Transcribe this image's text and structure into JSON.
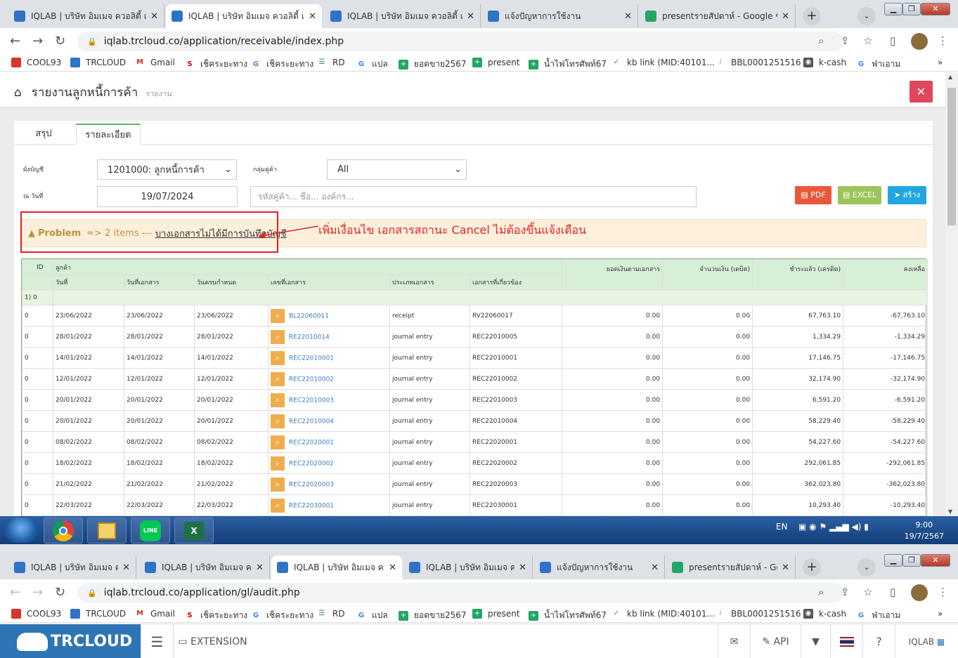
{
  "browser1": {
    "tabs": [
      {
        "title": "IQLAB | บริษัท อิมเมจ ควอลิตี้ แล็บ",
        "active": false
      },
      {
        "title": "IQLAB | บริษัท อิมเมจ ควอลิตี้ แล็บ",
        "active": true
      },
      {
        "title": "IQLAB | บริษัท อิมเมจ ควอลิตี้ แล็บ",
        "active": false
      },
      {
        "title": "แจ้งปัญหาการใช้งาน",
        "active": false
      },
      {
        "title": "presentรายสัปดาห์ - Google ชีต",
        "active": false
      }
    ],
    "url": "iqlab.trcloud.co/application/receivable/index.php"
  },
  "bookmarks": [
    "COOL93",
    "TRCLOUD",
    "Gmail",
    "เช็คระยะทาง",
    "เช็คระยะทาง",
    "RD",
    "แปล",
    "ยอดขาย2567",
    "present",
    "น้ำไฟโทรศัพท์67",
    "kb link (MID:40101...",
    "BBL0001251516",
    "k-cash",
    "ฟ่าเอาม"
  ],
  "page": {
    "title": "รายงานลูกหนี้การค้า",
    "subtitle": "รายงาน",
    "tabs": [
      "สรุป",
      "รายละเอียด"
    ],
    "filters": {
      "account_label": "ผังบัญชี",
      "account_value": "1201000: ลูกหนี้การค้า",
      "group_label": "กลุ่มคู่ค้า",
      "group_value": "All",
      "date_label": "ณ วันที่",
      "date_value": "19/07/2024",
      "search_placeholder": "รหัสคู่ค้า... ชื่อ... องค์กร..."
    },
    "buttons": {
      "pdf": "PDF",
      "excel": "EXCEL",
      "create": "สร้าง"
    },
    "alert": {
      "title": "Problem",
      "text": "=> 2 items ---",
      "link": "บางเอกสารไม่ได้มีการบันทึกบัญชี"
    },
    "annotation": "เพิ่มเงื่อนไข เอกสารสถานะ Cancel ไม่ต้องขึ้นแจ้งเตือน"
  },
  "table": {
    "h_id": "ID",
    "h_customer": "ลูกค้า",
    "h_doc_amount": "ยอดเงินตามเอกสาร",
    "h_debit": "จำนวนเงิน (เดบิต)",
    "h_credit": "ชำระแล้ว (เครดิต)",
    "h_balance": "คงเหลือ",
    "h_date": "วันที่",
    "h_doc_date": "วันที่เอกสาร",
    "h_due": "วันครบกำหนด",
    "h_doc_no": "เลขที่เอกสาร",
    "h_doc_type": "ประเภทเอกสาร",
    "h_ref": "เอกสารที่เกี่ยวข้อง",
    "group": {
      "idx": "1)",
      "id": "0"
    },
    "rows": [
      [
        "0",
        "23/06/2022",
        "23/06/2022",
        "23/06/2022",
        "BL22060011",
        "receipt",
        "RV22060017",
        "0.00",
        "0.00",
        "67,763.10",
        "-67,763.10"
      ],
      [
        "0",
        "28/01/2022",
        "28/01/2022",
        "28/01/2022",
        "RE22010014",
        "journal entry",
        "REC22010005",
        "0.00",
        "0.00",
        "1,334.29",
        "-1,334.29"
      ],
      [
        "0",
        "14/01/2022",
        "14/01/2022",
        "14/01/2022",
        "REC22010001",
        "journal entry",
        "REC22010001",
        "0.00",
        "0.00",
        "17,146.75",
        "-17,146.75"
      ],
      [
        "0",
        "12/01/2022",
        "12/01/2022",
        "12/01/2022",
        "REC22010002",
        "journal entry",
        "REC22010002",
        "0.00",
        "0.00",
        "32,174.90",
        "-32,174.90"
      ],
      [
        "0",
        "20/01/2022",
        "20/01/2022",
        "20/01/2022",
        "REC22010003",
        "journal entry",
        "REC22010003",
        "0.00",
        "0.00",
        "6,591.20",
        "-6,591.20"
      ],
      [
        "0",
        "20/01/2022",
        "20/01/2022",
        "20/01/2022",
        "REC22010004",
        "journal entry",
        "REC22010004",
        "0.00",
        "0.00",
        "58,229.40",
        "-58,229.40"
      ],
      [
        "0",
        "08/02/2022",
        "08/02/2022",
        "08/02/2022",
        "REC22020001",
        "journal entry",
        "REC22020001",
        "0.00",
        "0.00",
        "54,227.60",
        "-54,227.60"
      ],
      [
        "0",
        "18/02/2022",
        "18/02/2022",
        "18/02/2022",
        "REC22020002",
        "journal entry",
        "REC22020002",
        "0.00",
        "0.00",
        "292,061.85",
        "-292,061.85"
      ],
      [
        "0",
        "21/02/2022",
        "21/02/2022",
        "21/02/2022",
        "REC22020003",
        "journal entry",
        "REC22020003",
        "0.00",
        "0.00",
        "362,023.80",
        "-362,023.80"
      ],
      [
        "0",
        "22/03/2022",
        "22/03/2022",
        "22/03/2022",
        "REC22030001",
        "journal entry",
        "REC22030001",
        "0.00",
        "0.00",
        "10,293.40",
        "-10,293.40"
      ]
    ]
  },
  "taskbar": {
    "lang": "EN",
    "time": "9:00",
    "date": "19/7/2567"
  },
  "browser2": {
    "tabs": [
      {
        "title": "IQLAB | บริษัท อิมเมจ ควอลิตี้",
        "active": false
      },
      {
        "title": "IQLAB | บริษัท อิมเมจ ควอลิตี้",
        "active": false
      },
      {
        "title": "IQLAB | บริษัท อิมเมจ ควอลิตี้",
        "active": true
      },
      {
        "title": "IQLAB | บริษัท อิมเมจ ควอลิตี้",
        "active": false
      },
      {
        "title": "แจ้งปัญหาการใช้งาน",
        "active": false
      },
      {
        "title": "presentรายสัปดาห์ - Google ชีต",
        "active": false
      }
    ],
    "url": "iqlab.trcloud.co/application/gl/audit.php",
    "logo": "TRCLOUD",
    "extension": "EXTENSION",
    "api": "API",
    "company": "IQLAB"
  },
  "colors": {
    "accent": "#5cb85c",
    "danger": "#e52025",
    "pdf": "#e8593b",
    "excel": "#9bc55a",
    "create": "#23a6e0"
  }
}
